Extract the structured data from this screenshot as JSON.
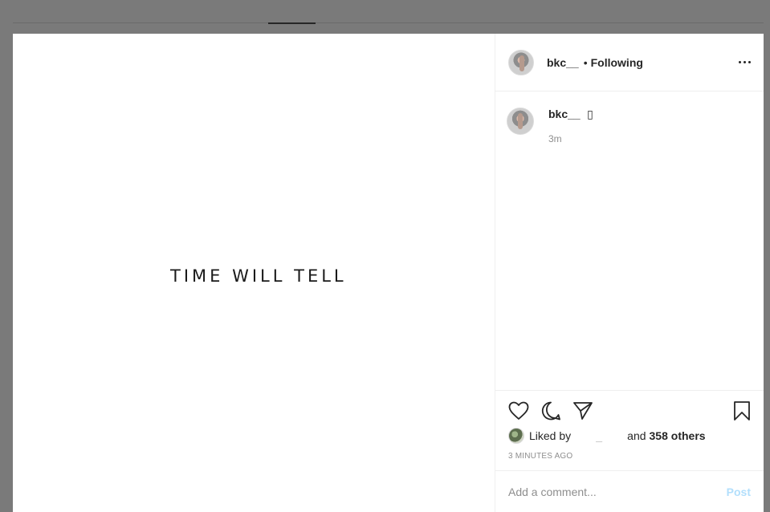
{
  "post": {
    "image_text": "TIME WILL TELL"
  },
  "header": {
    "username": "bkc__",
    "separator": "•",
    "follow_status": "Following",
    "more_icon": "more-options-icon"
  },
  "caption": {
    "username": "bkc__",
    "text": "▯",
    "time": "3m"
  },
  "actions": {
    "icons": [
      "heart-icon",
      "comment-icon",
      "share-icon",
      "bookmark-icon"
    ]
  },
  "likes": {
    "prefix": "Liked by",
    "hidden_user": "_",
    "and": "and",
    "count": "358 others"
  },
  "timestamp": "3 MINUTES AGO",
  "comment": {
    "placeholder": "Add a comment...",
    "post_label": "Post"
  },
  "colors": {
    "overlay": "#7a7a7a",
    "text": "#262626",
    "muted": "#8e8e8e",
    "post_disabled": "#b2dffc"
  }
}
